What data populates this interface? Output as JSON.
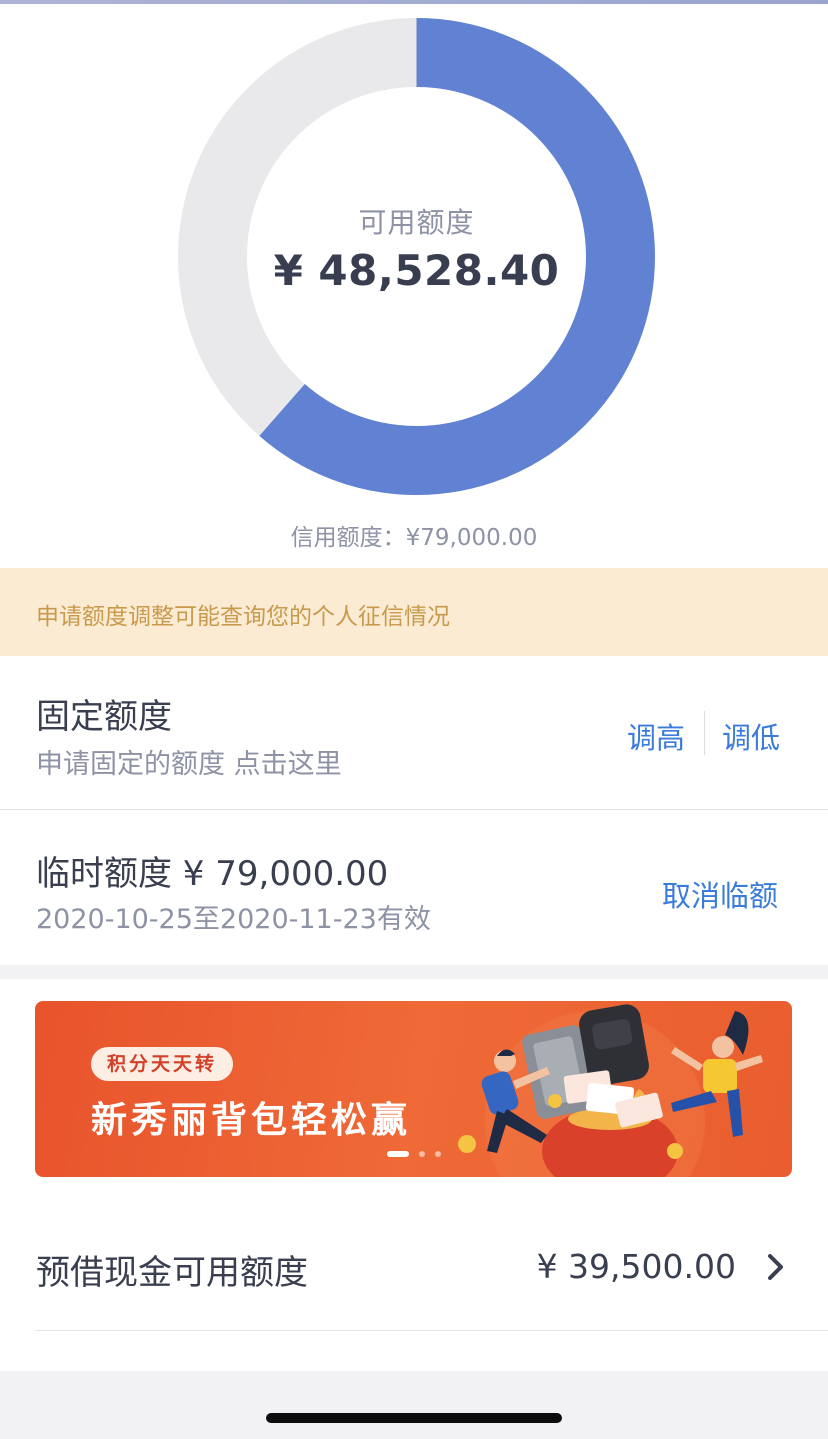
{
  "summary": {
    "available_label": "可用额度",
    "available_amount": "¥ 48,528.40",
    "credit_total": "信用额度：¥79,000.00",
    "available_fraction": 0.6143
  },
  "notice": {
    "text": "申请额度调整可能查询您的个人征信情况"
  },
  "fixed_limit": {
    "title": "固定额度",
    "subtitle": "申请固定的额度 点击这里",
    "raise_label": "调高",
    "lower_label": "调低"
  },
  "temp_limit": {
    "title": "临时额度 ¥ 79,000.00",
    "validity": "2020-10-25至2020-11-23有效",
    "cancel_label": "取消临额"
  },
  "banner": {
    "tag": "积分天天转",
    "headline": "新秀丽背包轻松赢",
    "page_count": 3,
    "active_page": 1
  },
  "cash_advance": {
    "title": "预借现金可用额度",
    "amount": "¥ 39,500.00"
  },
  "colors": {
    "ring_used": "#e9e9ec",
    "ring_available": "#6181d2",
    "link": "#3b7bd9",
    "notice_bg": "#faebd2",
    "notice_text": "#c99a4e"
  },
  "icons": {
    "cash_chevron": "chevron-right-icon"
  }
}
